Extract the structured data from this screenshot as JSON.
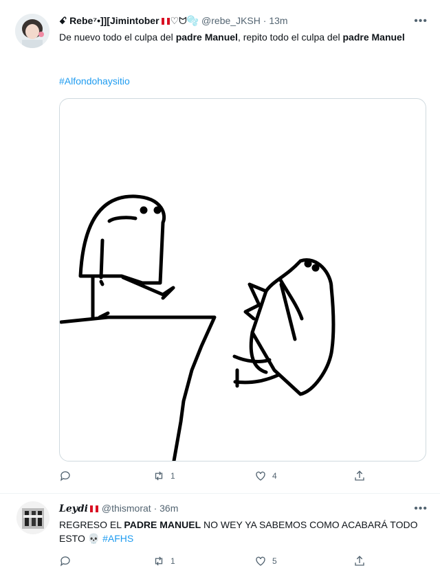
{
  "tweets": [
    {
      "display_name": "ꗃ Rebe⁷•]][Jimintober",
      "name_suffix": "♡ᗢ🫧",
      "handle": "@rebe_JKSH",
      "time": "13m",
      "text_1": "De nuevo todo el culpa del ",
      "bold_1": "padre Manuel",
      "text_2": ", repito todo el culpa del ",
      "bold_2": "padre Manuel",
      "hashtag": "#Alfondohaysitio",
      "retweets": "1",
      "likes": "4",
      "more": "•••"
    },
    {
      "display_name": "Leydi",
      "handle": "@thismorat",
      "time": "36m",
      "text_1": "REGRESO EL ",
      "bold_1": "PADRE MANUEL",
      "text_2": " NO WEY YA SABEMOS COMO ACABARÁ TODO ESTO ",
      "emoji": "💀",
      "hashtag": "#AFHS",
      "retweets": "1",
      "likes": "5",
      "more": "•••"
    }
  ],
  "sep": " · "
}
